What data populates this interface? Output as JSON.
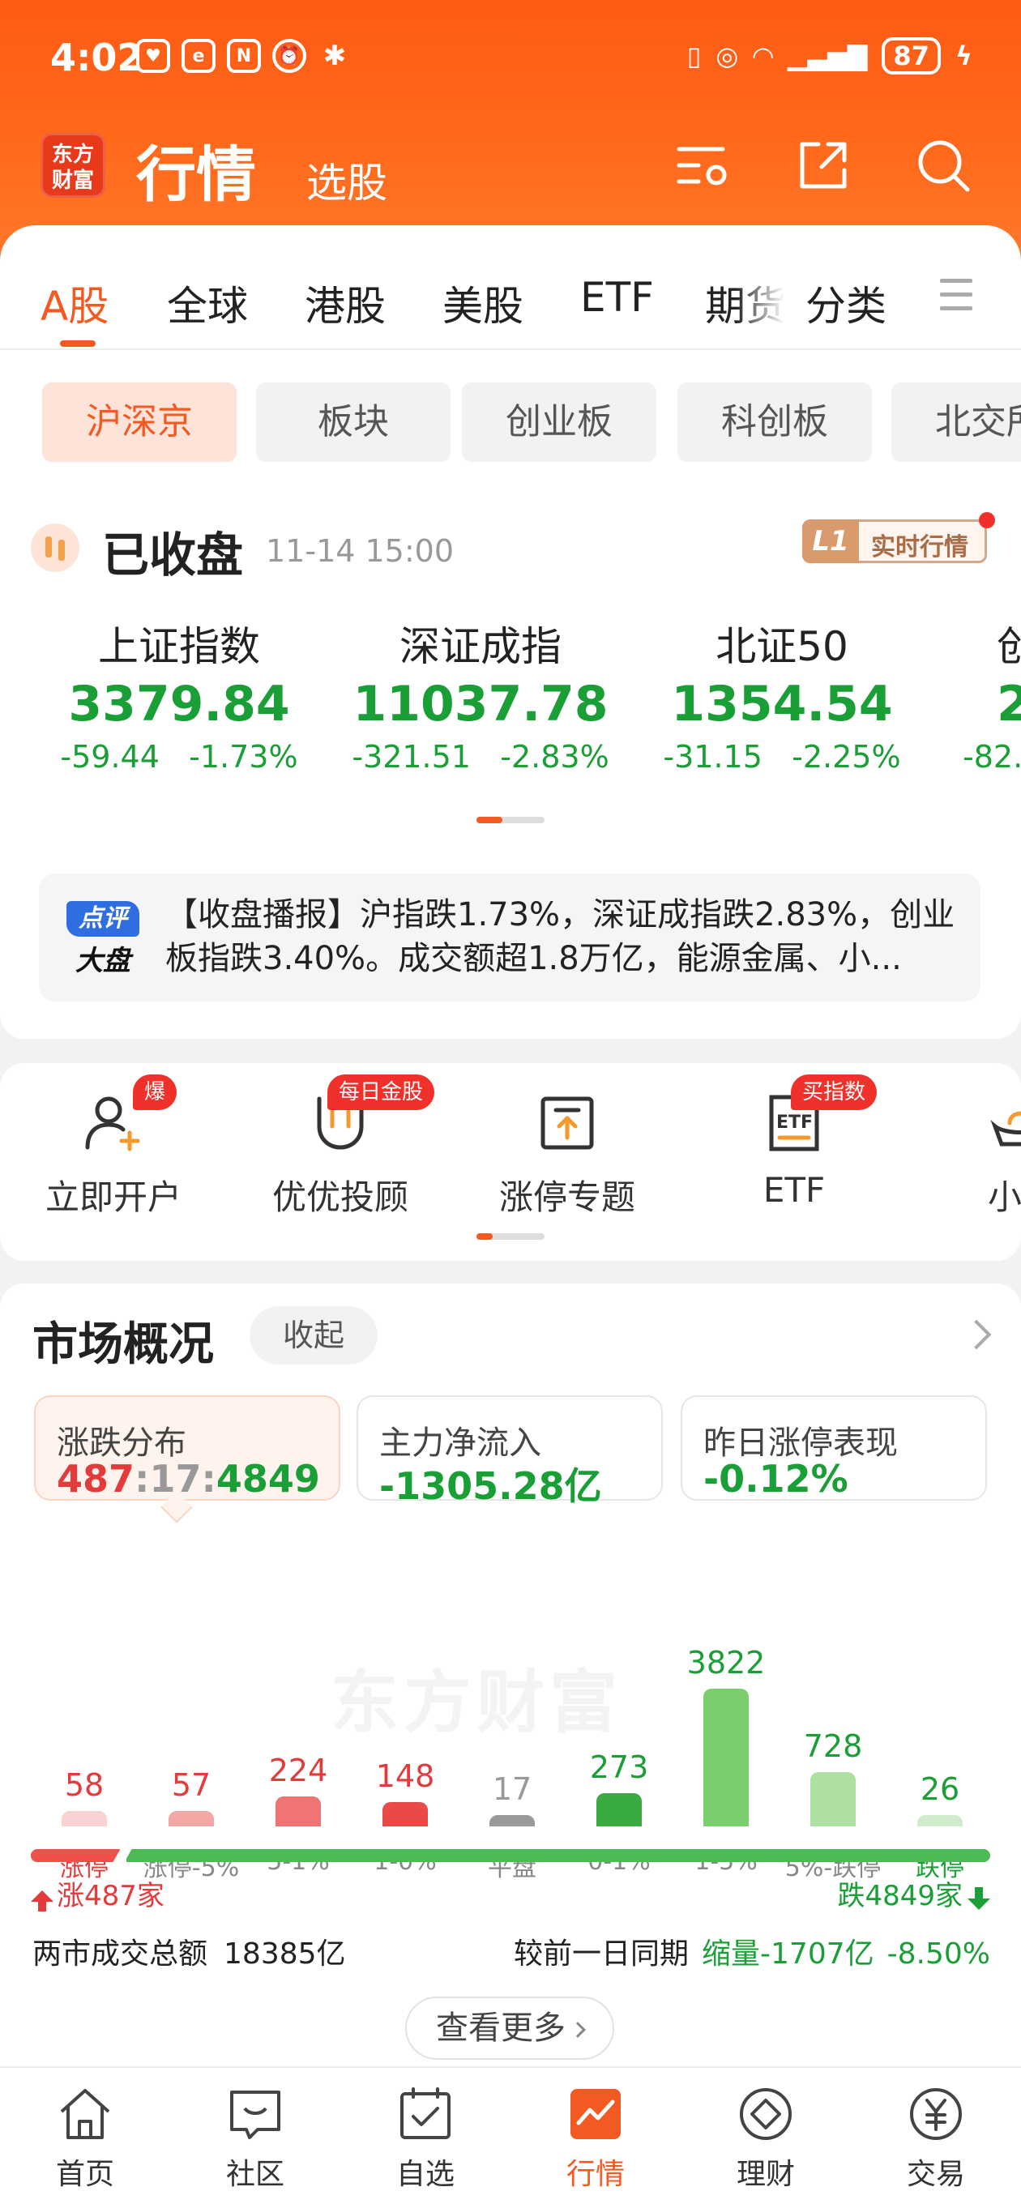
{
  "status_bar": {
    "time": "4:02",
    "battery": "87"
  },
  "topbar": {
    "logo": "东方财富",
    "title": "行情",
    "subtitle": "选股"
  },
  "tabs": [
    "A股",
    "全球",
    "港股",
    "美股",
    "ETF",
    "期货",
    "分类"
  ],
  "chips": [
    "沪深京",
    "板块",
    "创业板",
    "科创板",
    "北交所"
  ],
  "market_status": {
    "title": "已收盘",
    "time": "11-14 15:00",
    "badge_l1": "L1",
    "badge_text": "实时行情"
  },
  "indices": [
    {
      "name": "上证指数",
      "value": "3379.84",
      "change": "-59.44",
      "pct": "-1.73%"
    },
    {
      "name": "深证成指",
      "value": "11037.78",
      "change": "-321.51",
      "pct": "-2.83%"
    },
    {
      "name": "北证50",
      "value": "1354.54",
      "change": "-31.15",
      "pct": "-2.25%"
    },
    {
      "name": "创",
      "value": "2",
      "change": "-82.",
      "pct": ""
    }
  ],
  "news": {
    "badge_top": "点评",
    "badge_bottom": "大盘",
    "text": "【收盘播报】沪指跌1.73%，深证成指跌2.83%，创业板指跌3.40%。成交额超1.8万亿，能源金属、小..."
  },
  "services": [
    {
      "label": "立即开户",
      "tag": "爆",
      "icon": "user-add-icon"
    },
    {
      "label": "优优投顾",
      "tag": "每日金股",
      "icon": "magnet-icon"
    },
    {
      "label": "涨停专题",
      "tag": "",
      "icon": "upload-box-icon"
    },
    {
      "label": "ETF",
      "tag": "买指数",
      "icon": "etf-icon"
    },
    {
      "label": "小...",
      "tag": "",
      "icon": "ingot-icon"
    }
  ],
  "market_overview": {
    "title": "市场概况",
    "fold_label": "收起",
    "stats": [
      {
        "label": "涨跌分布",
        "up": "487",
        "flat": "17",
        "down": "4849"
      },
      {
        "label": "主力净流入",
        "value": "-1305.28亿"
      },
      {
        "label": "昨日涨停表现",
        "value": "-0.12%"
      }
    ],
    "watermark": "东方财富",
    "up_count": "涨487家",
    "down_count": "跌4849家",
    "turnover_label": "两市成交总额",
    "turnover_value": "18385亿",
    "compare_label": "较前一日同期",
    "compare_value": "缩量-1707亿",
    "compare_pct": "-8.50%",
    "more_label": "查看更多"
  },
  "chart_data": {
    "type": "bar",
    "categories": [
      "涨停",
      "涨停-5%",
      "5-1%",
      "1-0%",
      "平盘",
      "0-1%",
      "1-5%",
      "5%-跌停",
      "跌停"
    ],
    "values": [
      58,
      57,
      224,
      148,
      17,
      273,
      3822,
      728,
      26
    ],
    "colors": [
      "#f9d3d1",
      "#f4a8a6",
      "#ee7573",
      "#e94a48",
      "#9a9a9a",
      "#3aaa42",
      "#7ccd6e",
      "#aee0a2",
      "#cfeccb"
    ],
    "value_colors": [
      "#e33b3b",
      "#e33b3b",
      "#e33b3b",
      "#e33b3b",
      "#999999",
      "#1a9e36",
      "#1a9e36",
      "#1a9e36",
      "#1a9e36"
    ]
  },
  "bottom_nav": [
    "首页",
    "社区",
    "自选",
    "行情",
    "理财",
    "交易"
  ],
  "colors": {
    "brand": "#f35a22",
    "up": "#e33b3b",
    "down": "#1a9e36"
  }
}
